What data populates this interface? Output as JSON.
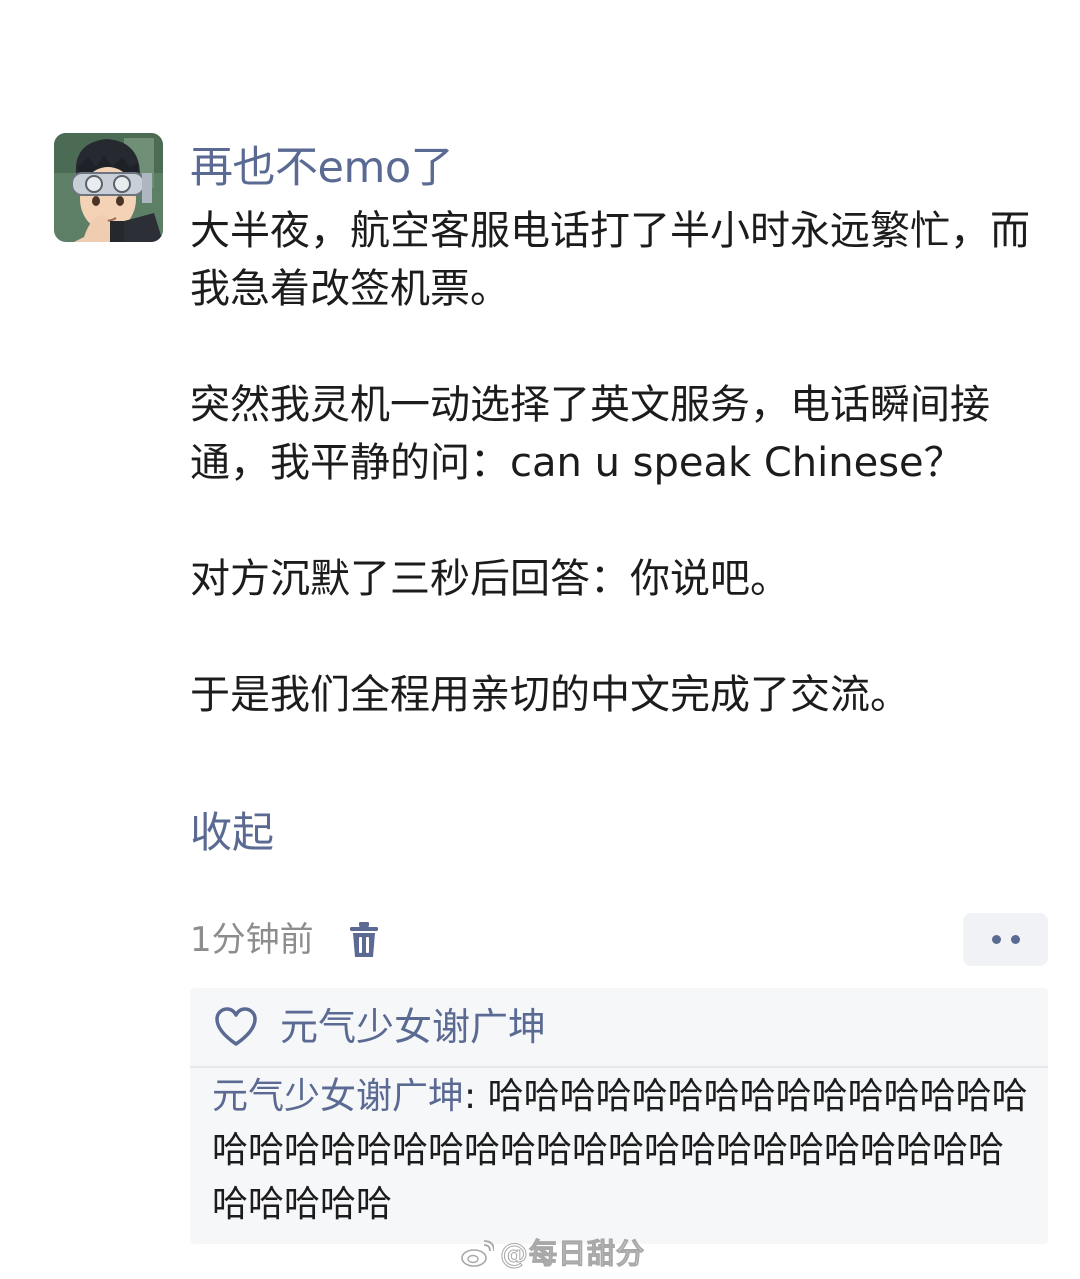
{
  "post": {
    "username": "再也不emo了",
    "paragraphs": [
      "大半夜，航空客服电话打了半小时永远繁忙，而我急着改签机票。",
      "突然我灵机一动选择了英文服务，电话瞬间接通，我平静的问：can u speak Chinese？",
      "对方沉默了三秒后回答：你说吧。",
      "于是我们全程用亲切的中文完成了交流。"
    ],
    "collapse_label": "收起",
    "timestamp": "1分钟前",
    "delete_icon": "trash-icon",
    "more_icon": "more-dots-icon",
    "accent_color": "#5b6a93"
  },
  "likes": {
    "icon": "heart-outline-icon",
    "names": "元气少女谢广坤"
  },
  "comments": [
    {
      "author": "元气少女谢广坤",
      "separator": ": ",
      "text": "哈哈哈哈哈哈哈哈哈哈哈哈哈哈哈哈哈哈哈哈哈哈哈哈哈哈哈哈哈哈哈哈哈哈哈哈哈哈哈哈哈哈"
    }
  ],
  "watermark": {
    "icon": "weibo-logo-icon",
    "text": "@每日甜分"
  }
}
